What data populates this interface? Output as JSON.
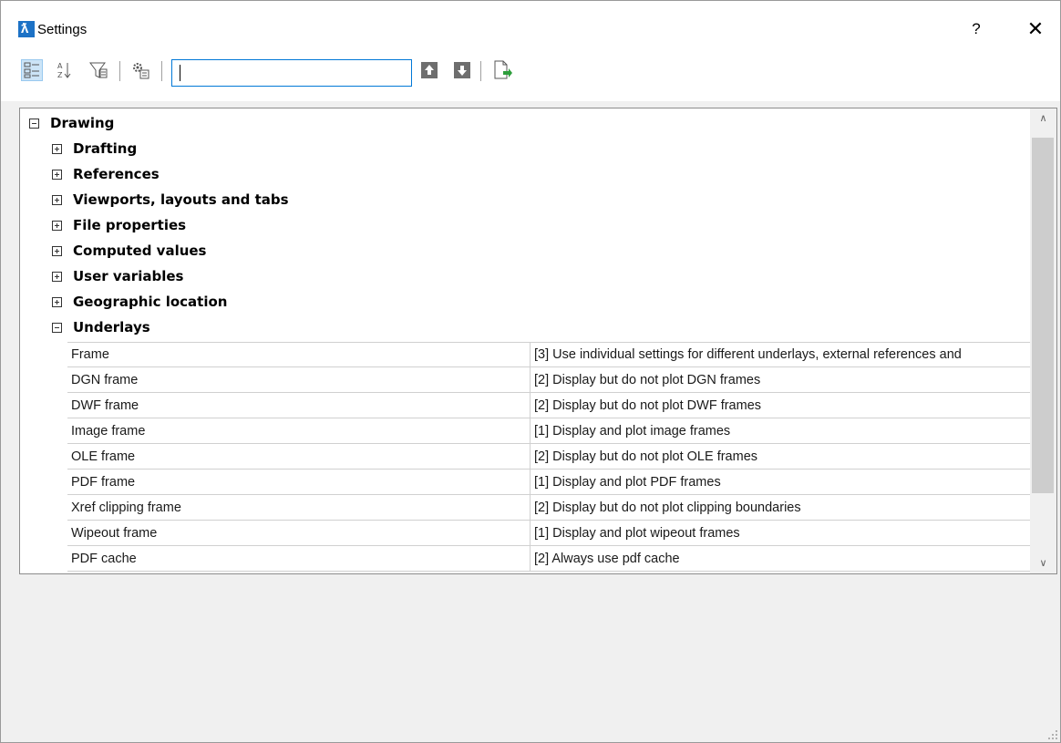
{
  "window": {
    "title": "Settings",
    "help_label": "?",
    "close_label": "✕",
    "app_icon_glyph": "ƛ"
  },
  "toolbar": {
    "buttons": [
      {
        "icon": "categorized-view-icon",
        "active": true
      },
      {
        "icon": "sort-alphabetical-icon"
      },
      {
        "icon": "filter-icon"
      },
      {
        "icon": "settings-gears-icon"
      },
      {
        "icon": "search-previous-icon"
      },
      {
        "icon": "search-next-icon"
      },
      {
        "icon": "export-icon"
      }
    ],
    "search": {
      "value": "",
      "placeholder": ""
    }
  },
  "tree": {
    "root": {
      "label": "Drawing",
      "expanded": true
    },
    "categories": [
      {
        "label": "Drafting",
        "expanded": false
      },
      {
        "label": "References",
        "expanded": false
      },
      {
        "label": "Viewports, layouts and tabs",
        "expanded": false
      },
      {
        "label": "File properties",
        "expanded": false
      },
      {
        "label": "Computed values",
        "expanded": false
      },
      {
        "label": "User variables",
        "expanded": false
      },
      {
        "label": "Geographic location",
        "expanded": false
      },
      {
        "label": "Underlays",
        "expanded": true
      }
    ],
    "underlay_props": [
      {
        "name": "Frame",
        "value": "[3] Use individual settings for different underlays, external references and"
      },
      {
        "name": "DGN frame",
        "value": "[2] Display but do not plot DGN frames"
      },
      {
        "name": "DWF frame",
        "value": "[2] Display but do not plot DWF frames"
      },
      {
        "name": "Image frame",
        "value": "[1] Display and plot image frames"
      },
      {
        "name": "OLE frame",
        "value": "[2] Display but do not plot OLE frames"
      },
      {
        "name": "PDF frame",
        "value": "[1] Display and plot PDF frames"
      },
      {
        "name": "Xref clipping frame",
        "value": "[2] Display but do not plot clipping boundaries"
      },
      {
        "name": "Wipeout frame",
        "value": "[1] Display and plot wipeout frames"
      },
      {
        "name": "PDF cache",
        "value": "[2] Always use pdf cache"
      }
    ]
  },
  "scrollbar": {
    "up_glyph": "∧",
    "down_glyph": "∨"
  },
  "colors": {
    "accent": "#0078d7",
    "app_icon": "#1d72c6",
    "selected_tool": "#cce4f7"
  }
}
